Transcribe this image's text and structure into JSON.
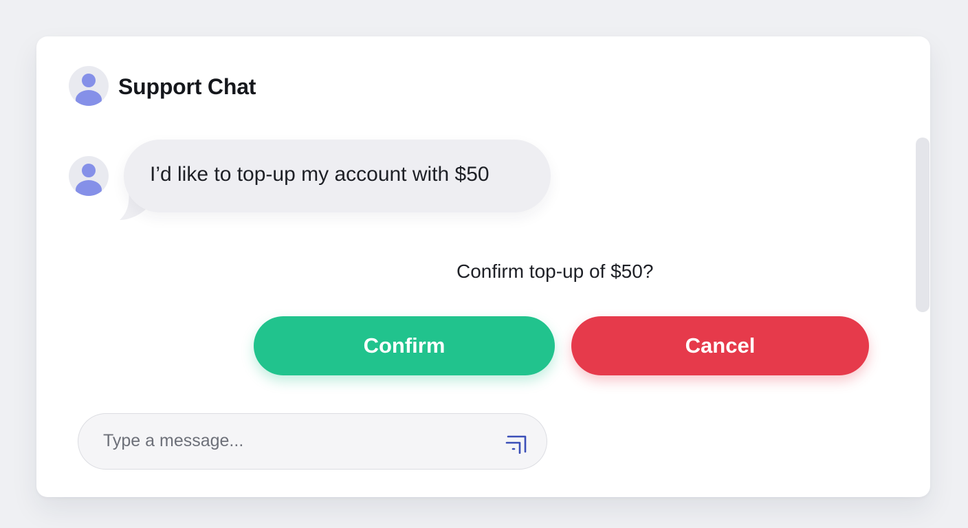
{
  "header": {
    "title": "Support Chat",
    "avatar_icon": "user-icon"
  },
  "messages": [
    {
      "sender_icon": "user-icon",
      "text": "I’d like to top-up my account with $50"
    }
  ],
  "confirmation": {
    "prompt": "Confirm top-up of $50?",
    "confirm_label": "Confirm",
    "cancel_label": "Cancel",
    "confirm_color": "#21c38d",
    "cancel_color": "#e63a4b"
  },
  "composer": {
    "placeholder": "Type a message...",
    "value": "",
    "send_icon": "send-icon"
  },
  "theme": {
    "avatar_accent": "#8590e8",
    "background": "#eff0f3"
  }
}
